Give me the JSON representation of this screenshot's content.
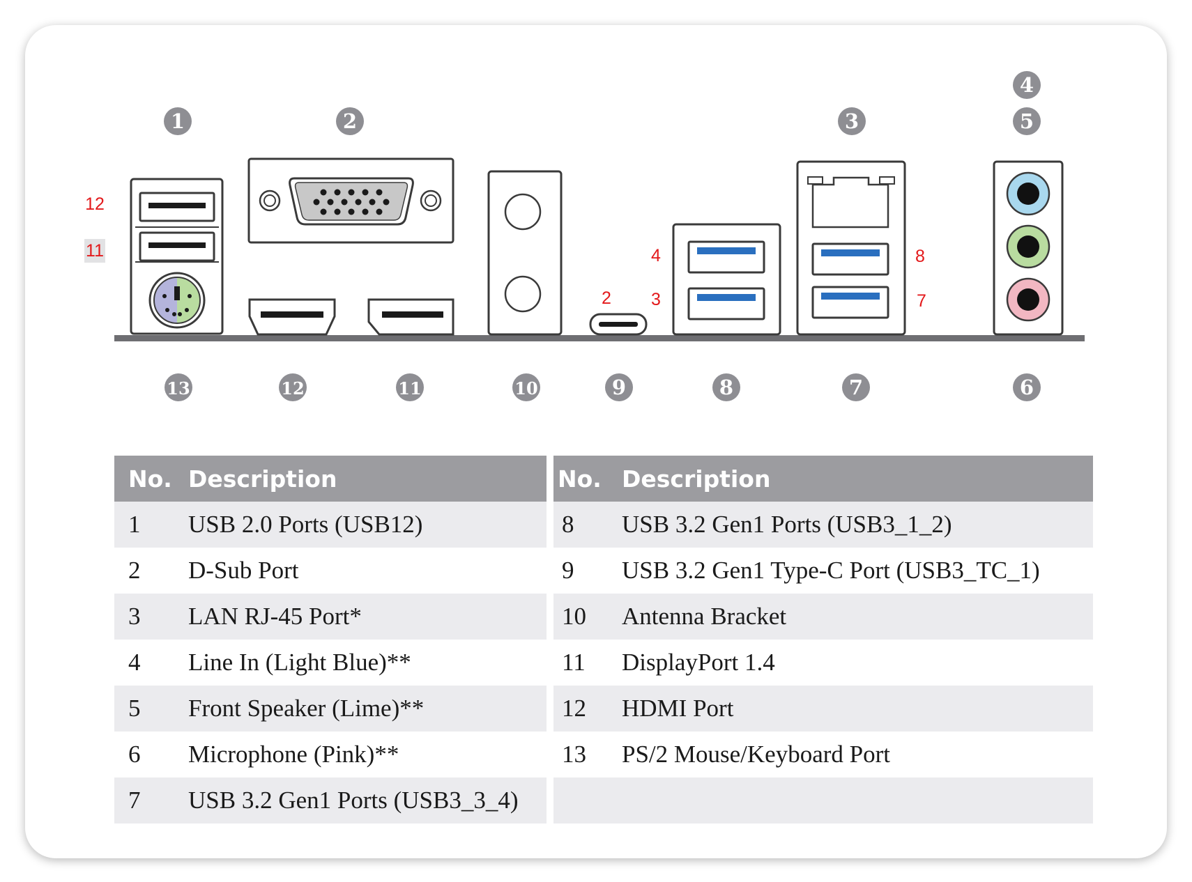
{
  "badges_top": [
    {
      "id": "1",
      "label": "1"
    },
    {
      "id": "2",
      "label": "2"
    },
    {
      "id": "3",
      "label": "3"
    },
    {
      "id": "4",
      "label": "4"
    },
    {
      "id": "5",
      "label": "5"
    }
  ],
  "badges_bottom": [
    {
      "id": "13",
      "label": "13"
    },
    {
      "id": "12",
      "label": "12"
    },
    {
      "id": "11",
      "label": "11"
    },
    {
      "id": "10",
      "label": "10"
    },
    {
      "id": "9",
      "label": "9"
    },
    {
      "id": "8",
      "label": "8"
    },
    {
      "id": "7",
      "label": "7"
    },
    {
      "id": "6",
      "label": "6"
    }
  ],
  "red_labels": {
    "usb2_top": "12",
    "usb2_bottom": "11",
    "typec": "2",
    "usb3_left_top": "4",
    "usb3_left_bottom": "3",
    "usb3_right_top": "8",
    "usb3_right_bottom": "7"
  },
  "colors": {
    "badge": "#8e8e93",
    "red_label": "#e3191b",
    "usb3_blue": "#2a6fbf",
    "audio_light_blue": "#a9d8ee",
    "audio_lime": "#b9dca0",
    "audio_pink": "#f2b7c2",
    "ps2_purple": "#b4b4dc",
    "ps2_green": "#b9dca0",
    "header_bg": "#9c9ca0",
    "row_shade": "#ebebee"
  },
  "table": {
    "header_no": "No.",
    "header_desc": "Description",
    "left": [
      {
        "no": "1",
        "desc": "USB 2.0 Ports (USB12)"
      },
      {
        "no": "2",
        "desc": "D-Sub Port"
      },
      {
        "no": "3",
        "desc": "LAN RJ-45 Port*"
      },
      {
        "no": "4",
        "desc": "Line In (Light Blue)**"
      },
      {
        "no": "5",
        "desc": "Front Speaker (Lime)**"
      },
      {
        "no": "6",
        "desc": "Microphone (Pink)**"
      },
      {
        "no": "7",
        "desc": "USB 3.2 Gen1 Ports (USB3_3_4)"
      }
    ],
    "right": [
      {
        "no": "8",
        "desc": "USB 3.2 Gen1 Ports (USB3_1_2)"
      },
      {
        "no": "9",
        "desc": "USB 3.2 Gen1 Type-C Port (USB3_TC_1)"
      },
      {
        "no": "10",
        "desc": "Antenna Bracket"
      },
      {
        "no": "11",
        "desc": "DisplayPort 1.4"
      },
      {
        "no": "12",
        "desc": "HDMI Port"
      },
      {
        "no": "13",
        "desc": "PS/2 Mouse/Keyboard Port"
      },
      {
        "no": "",
        "desc": ""
      }
    ]
  }
}
